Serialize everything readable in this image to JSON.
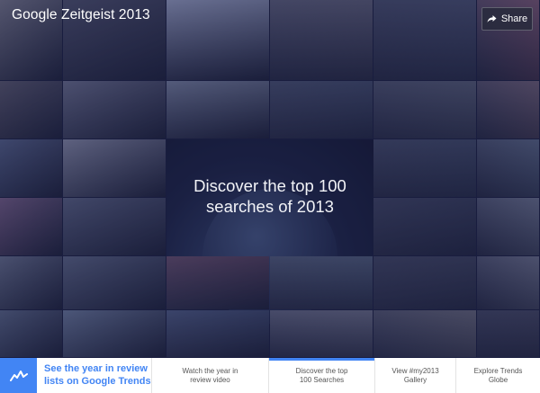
{
  "header": {
    "logo_brand": "Google",
    "logo_product": "Zeitgeist 2013",
    "share_label": "Share"
  },
  "hero": {
    "headline_line1": "Discover the top 100",
    "headline_line2": "searches of 2013"
  },
  "mosaic": {
    "tiles": [
      {
        "name": "tile-1",
        "color": "#6b6a7a"
      },
      {
        "name": "tile-2",
        "color": "#3c3e58"
      },
      {
        "name": "tile-3",
        "color": "#8f97b8"
      },
      {
        "name": "tile-4",
        "color": "#5a5a72"
      },
      {
        "name": "tile-5",
        "color": "#434a6a"
      },
      {
        "name": "tile-6",
        "color": "#7b4f69"
      },
      {
        "name": "tile-7",
        "color": "#4a4658"
      },
      {
        "name": "tile-8",
        "color": "#5d607c"
      },
      {
        "name": "tile-9",
        "color": "#6a738f"
      },
      {
        "name": "tile-10",
        "color": "#3d4766"
      },
      {
        "name": "tile-11",
        "color": "#545a72"
      },
      {
        "name": "tile-12",
        "color": "#6e5a6e"
      },
      {
        "name": "tile-13",
        "color": "#445077"
      },
      {
        "name": "tile-14",
        "color": "#7c7f98"
      },
      {
        "name": "tile-15",
        "color": "#3b4563"
      },
      {
        "name": "tile-16",
        "color": "#55627f"
      },
      {
        "name": "tile-17",
        "color": "#6a4d74"
      },
      {
        "name": "tile-18",
        "color": "#4a5170"
      },
      {
        "name": "tile-19",
        "color": "#2f3552"
      },
      {
        "name": "tile-20",
        "color": "#697089"
      },
      {
        "name": "tile-21",
        "color": "#58607b"
      },
      {
        "name": "tile-22",
        "color": "#4d5674"
      },
      {
        "name": "tile-23",
        "color": "#5a3c58"
      },
      {
        "name": "tile-24",
        "color": "#4f5d7a"
      },
      {
        "name": "tile-25",
        "color": "#363b56"
      },
      {
        "name": "tile-26",
        "color": "#6a6e86"
      },
      {
        "name": "tile-27",
        "color": "#4a5675"
      },
      {
        "name": "tile-28",
        "color": "#5c6b8c"
      },
      {
        "name": "tile-29",
        "color": "#3d4a72"
      },
      {
        "name": "tile-30",
        "color": "#6f7189"
      }
    ]
  },
  "bottom_nav": {
    "trends_cta": "See the year in review lists on Google Trends",
    "items": [
      {
        "label": "Watch the year in\nreview video",
        "active": false
      },
      {
        "label": "Discover the top\n100 Searches",
        "active": true
      },
      {
        "label": "View #my2013\nGallery",
        "active": false
      },
      {
        "label": "Explore Trends\nGlobe",
        "active": false
      }
    ]
  },
  "colors": {
    "accent": "#4285f4",
    "overlay": "#1b1e3a"
  }
}
